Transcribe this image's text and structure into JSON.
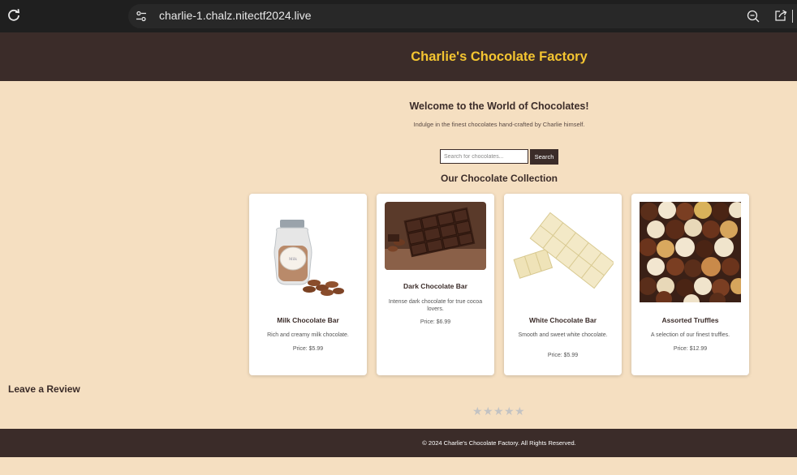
{
  "browser": {
    "url": "charlie-1.chalz.nitectf2024.live",
    "icons": [
      "reload-icon",
      "site-settings-icon",
      "zoom-out-icon",
      "share-icon"
    ]
  },
  "header": {
    "title": "Charlie's Chocolate Factory",
    "title_color": "#f4c531",
    "bg": "#3b2c29"
  },
  "main": {
    "welcome": "Welcome to the World of Chocolates!",
    "tagline": "Indulge in the finest chocolates hand-crafted by Charlie himself.",
    "search": {
      "placeholder": "Search for chocolates...",
      "button": "Search"
    },
    "collection_title": "Our Chocolate Collection",
    "products": [
      {
        "name": "Milk Chocolate Bar",
        "description": "Rich and creamy milk chocolate.",
        "price": "Price: $5.99",
        "image": "milk-chocolate-jar-image"
      },
      {
        "name": "Dark Chocolate Bar",
        "description": "Intense dark chocolate for true cocoa lovers.",
        "price": "Price: $6.99",
        "image": "dark-chocolate-bar-image"
      },
      {
        "name": "White Chocolate Bar",
        "description": "Smooth and sweet white chocolate.",
        "price": "Price: $5.99",
        "image": "white-chocolate-bar-image"
      },
      {
        "name": "Assorted Truffles",
        "description": "A selection of our finest truffles.",
        "price": "Price: $12.99",
        "image": "assorted-truffles-image"
      }
    ]
  },
  "review": {
    "title": "Leave a Review",
    "stars": [
      "★",
      "★",
      "★",
      "★",
      "★"
    ],
    "rating": 0
  },
  "footer": {
    "text": "© 2024 Charlie's Chocolate Factory. All Rights Reserved."
  }
}
